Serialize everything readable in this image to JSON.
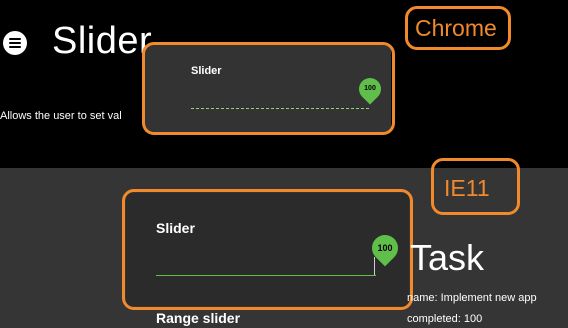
{
  "page": {
    "title": "Slider",
    "subtitle": "Allows the user to set val"
  },
  "annotations": {
    "chrome_label": "Chrome",
    "ie11_label": "IE11"
  },
  "chrome_card": {
    "slider_label": "Slider",
    "value": "100"
  },
  "ie11_card": {
    "slider_label": "Slider",
    "value": "100",
    "range_label": "Range slider"
  },
  "task": {
    "title": "Task",
    "name_line": "name: Implement new app",
    "completed_line": "completed: 100"
  },
  "colors": {
    "accent_orange": "#f08a2c",
    "slider_green": "#5fbf4a",
    "top_bg": "#000000",
    "bottom_bg": "#353535"
  }
}
